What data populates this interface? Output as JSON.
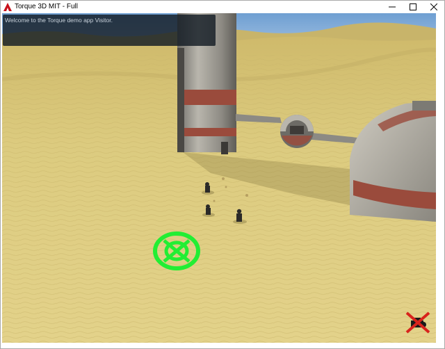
{
  "window": {
    "title": "Torque 3D MIT - Full",
    "app_icon": "torque-logo-icon",
    "buttons": [
      "minimize-icon",
      "maximize-icon",
      "close-icon"
    ]
  },
  "hud": {
    "message": "Welcome to the Torque demo app Visitor.",
    "target_marker_icon": "target-reticle-icon",
    "status_icon": "no-connection-icon"
  },
  "colors": {
    "sky": "#7fa9d6",
    "sand": "#dccb7f",
    "target_green": "#22ee33",
    "status_red": "#d8231c",
    "panel_bg": "#141c24"
  }
}
